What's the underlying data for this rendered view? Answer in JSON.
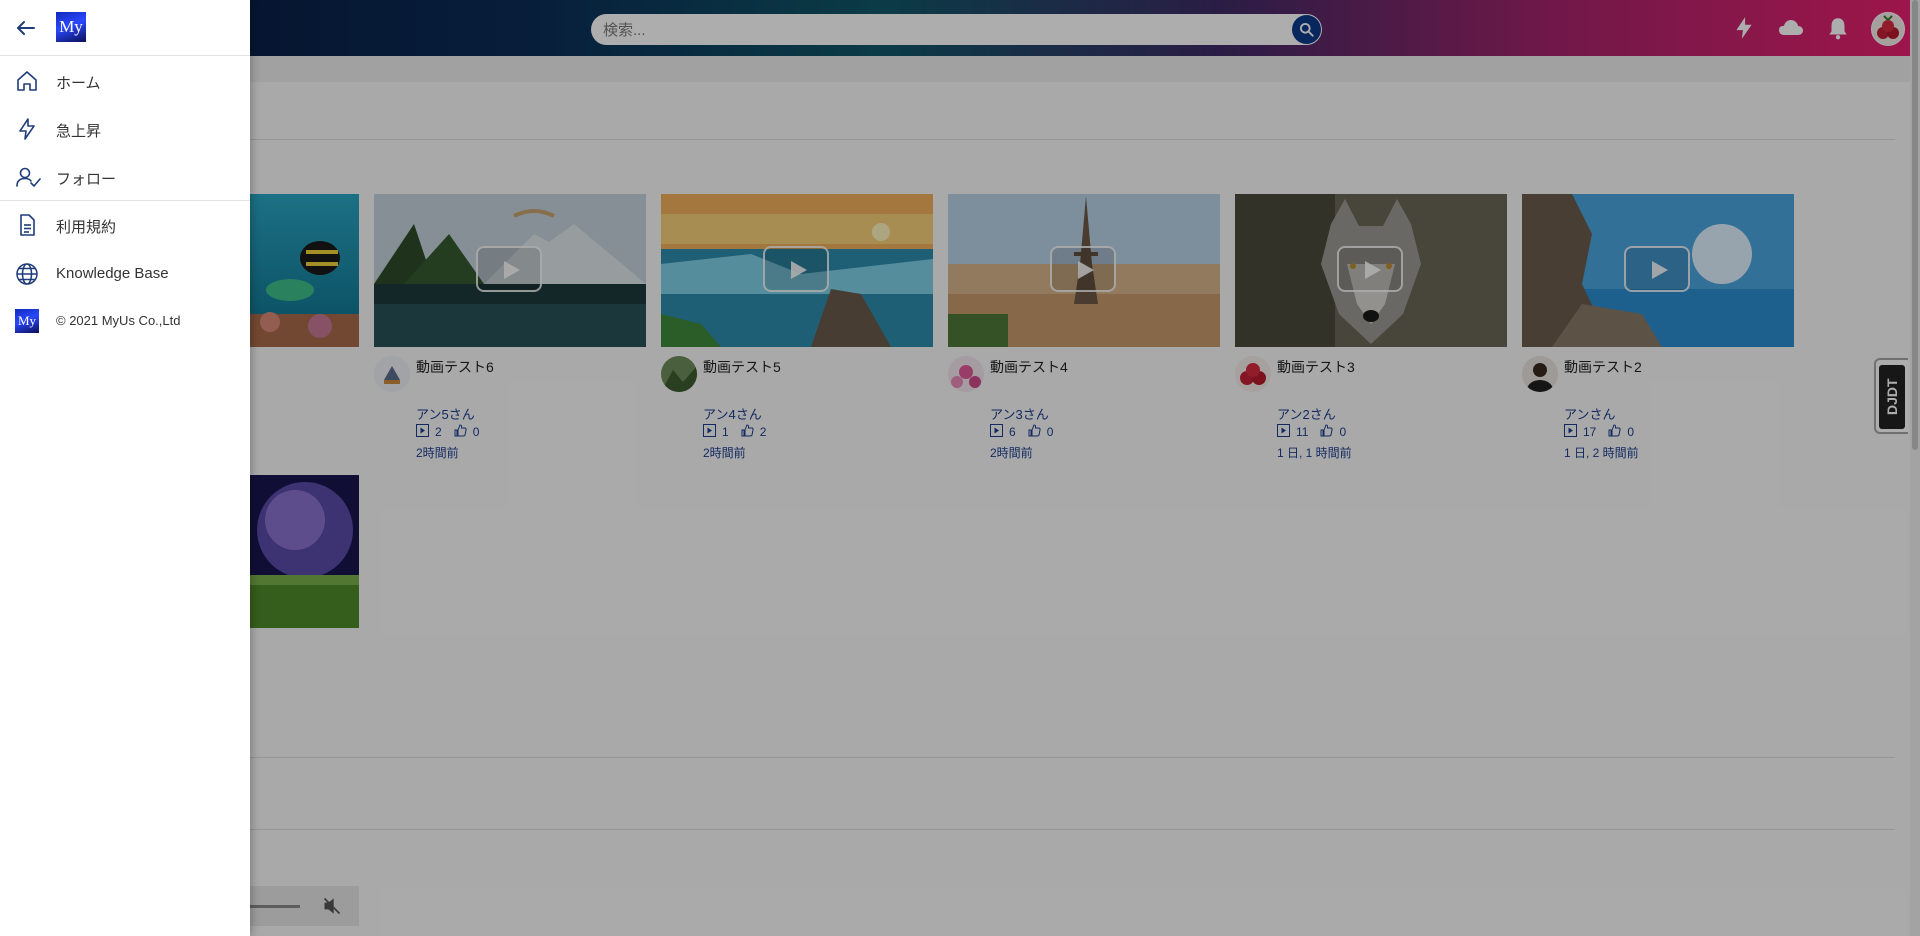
{
  "header": {
    "search_placeholder": "検索..."
  },
  "drawer": {
    "logo_text": "My",
    "items": [
      {
        "label": "ホーム",
        "icon": "home-icon"
      },
      {
        "label": "急上昇",
        "icon": "lightning-icon"
      },
      {
        "label": "フォロー",
        "icon": "user-follow-icon"
      },
      {
        "label": "利用規約",
        "icon": "document-icon"
      },
      {
        "label": "Knowledge Base",
        "icon": "globe-icon"
      }
    ],
    "copyright": "© 2021 MyUs Co.,Ltd"
  },
  "videos": [
    {
      "title": "動画テスト6",
      "channel": "アン5さん",
      "views": "2",
      "likes": "0",
      "time": "2時間前"
    },
    {
      "title": "動画テスト5",
      "channel": "アン4さん",
      "views": "1",
      "likes": "2",
      "time": "2時間前"
    },
    {
      "title": "動画テスト4",
      "channel": "アン3さん",
      "views": "6",
      "likes": "0",
      "time": "2時間前"
    },
    {
      "title": "動画テスト3",
      "channel": "アン2さん",
      "views": "11",
      "likes": "0",
      "time": "1 日, 1 時間前"
    },
    {
      "title": "動画テスト2",
      "channel": "アンさん",
      "views": "17",
      "likes": "0",
      "time": "1 日, 2 時間前"
    }
  ],
  "side_tab": {
    "label": "DJDT"
  },
  "colors": {
    "brand_blue": "#0d3a8c",
    "link_blue": "#1c3f8f",
    "header_pink": "#e8206e"
  }
}
